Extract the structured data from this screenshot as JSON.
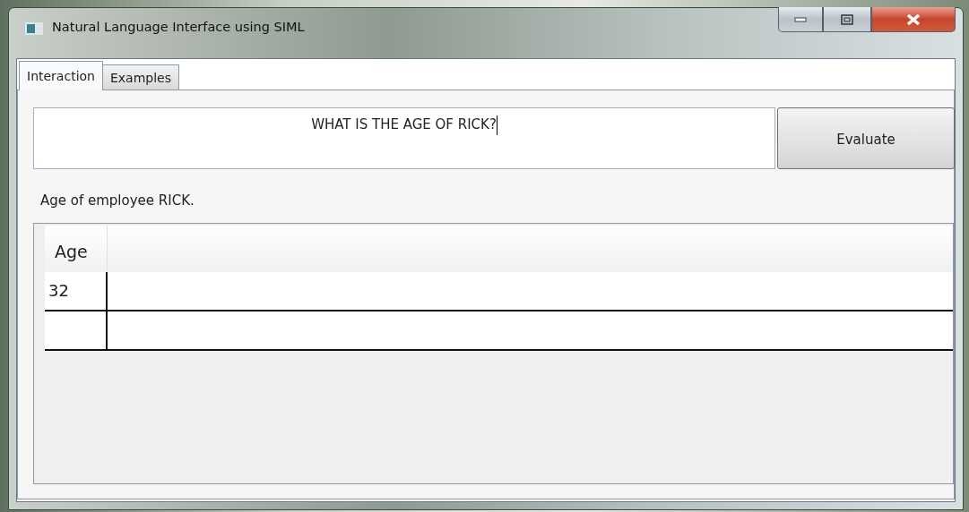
{
  "window": {
    "title": "Natural Language Interface using SIML"
  },
  "tabs": [
    {
      "label": "Interaction",
      "selected": true
    },
    {
      "label": "Examples",
      "selected": false
    }
  ],
  "query": {
    "value": "WHAT IS THE AGE OF RICK?",
    "focused": true
  },
  "evaluate_button": {
    "label": "Evaluate"
  },
  "result_text": "Age of employee RICK.",
  "table": {
    "columns": [
      "Age"
    ],
    "rows": [
      {
        "kind": "data",
        "cells": [
          "32"
        ]
      },
      {
        "kind": "new-row"
      }
    ]
  }
}
